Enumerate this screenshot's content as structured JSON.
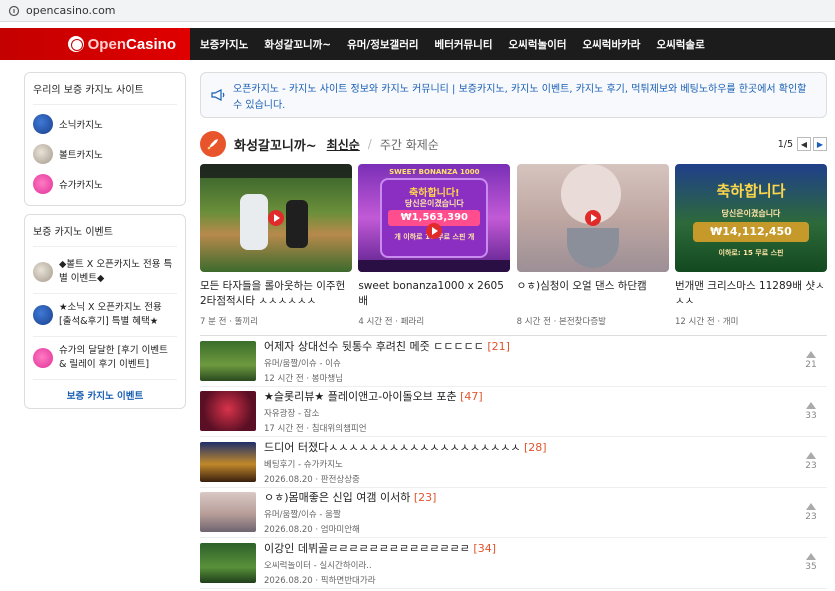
{
  "browser": {
    "url": "opencasino.com"
  },
  "brand": {
    "logo_open": "Open",
    "logo_casino": "Casino"
  },
  "menu": [
    "보증카지노",
    "화성갈꼬니까~",
    "유머/정보갤러리",
    "베터커뮤니티",
    "오씨럭놀이터",
    "오씨럭바카라",
    "오씨럭솔로"
  ],
  "sidebar": {
    "sites_title": "우리의 보증 카지노 사이트",
    "sites": [
      {
        "label": "소닉카지노",
        "icon": "sonic-icon"
      },
      {
        "label": "볼트카지노",
        "icon": "bolt-rabbit-icon"
      },
      {
        "label": "슈가카지노",
        "icon": "paw-icon"
      }
    ],
    "events_title": "보증 카지노 이벤트",
    "events": [
      {
        "label": "◆볼트 X 오픈카지노 전용 특별 이벤트◆",
        "icon": "bolt-rabbit-icon"
      },
      {
        "label": "★소닉 X 오픈카지노 전용 [출석&후기] 특별 혜택★",
        "icon": "sonic-icon"
      },
      {
        "label": "슈가의 달달한 [후기 이벤트 & 릴레이 후기 이벤트]",
        "icon": "paw-icon"
      }
    ],
    "events_link": "보증 카지노 이벤트"
  },
  "notice": {
    "text": "오픈카지노 - 카지노 사이트 정보와 카지노 커뮤니티 | 보증카지노, 카지노 이벤트, 카지노 후기, 먹튀제보와 베팅노하우를 한곳에서 확인할 수 있습니다."
  },
  "section": {
    "title": "화성갈꼬니까~",
    "tab_active": "최신순",
    "tab_other": "주간 화제순",
    "page": "1/5"
  },
  "cards": [
    {
      "title": "모든 타자들을 롤아웃하는 이주헌 2타점적시타 ㅅㅅㅅㅅㅅㅅ",
      "time": "7 분 전",
      "author": "똘끼리",
      "overlay": ""
    },
    {
      "title": "sweet bonanza1000 x 2605배",
      "time": "4 시간 전",
      "author": "페라리",
      "overlay": "축하합니다!|당신은이겼습니다|₩1,563,390|개 이하로 10 무료 스핀 개",
      "bonanza": "SWEET BONANZA 1000"
    },
    {
      "title": "ㅇㅎ)심청이 오얼 댄스 하단캠",
      "time": "8 시간 전",
      "author": "본전찾다증발",
      "overlay": ""
    },
    {
      "title": "번개맨 크리스마스 11289배 샷ㅅㅅㅅ",
      "time": "12 시간 전",
      "author": "개미",
      "overlay": "축하합니다|당신은이겼습니다|₩14,112,450|이하로: 15 무료 스핀"
    }
  ],
  "posts": [
    {
      "title": "어제자 상대선수 뒷통수 후려친 메줏 ㄷㄷㄷㄷㄷ",
      "count": "[21]",
      "category": "유머/움짤/이슈 - 이슈",
      "time": "12 시간 전",
      "author": "봉마챙님",
      "votes": "21"
    },
    {
      "title": "★슬롯리뷰★ 플레이앤고-아이돌오브 포춘",
      "count": "[47]",
      "category": "자유광장 - 잡소",
      "time": "17 시간 전",
      "author": "침대위의챔피언",
      "votes": "33"
    },
    {
      "title": "드디어 터졌다ㅅㅅㅅㅅㅅㅅㅅㅅㅅㅅㅅㅅㅅㅅㅅㅅㅅㅅㅅ",
      "count": "[28]",
      "category": "베팅후기 - 슈가카지노",
      "time": "2026.08.20",
      "author": "판전상상중",
      "votes": "23"
    },
    {
      "title": "ㅇㅎ)몸매좋은 신입 여갬 이서하",
      "count": "[23]",
      "category": "유머/움짤/이슈 - 움짤",
      "time": "2026.08.20",
      "author": "엄마미안해",
      "votes": "23"
    },
    {
      "title": "이강인 데뷔골ㄹㄹㄹㄹㄹㄹㄹㄹㄹㄹㄹㄹㄹㄹ",
      "count": "[34]",
      "category": "오씨럭놀이터 - 실시간하이라..",
      "time": "2026.08.20",
      "author": "픽하면반대가라",
      "votes": "35"
    }
  ],
  "colors": {
    "accent_red": "#e00000",
    "link_blue": "#1a5fb4",
    "count_orange": "#e1542d"
  }
}
